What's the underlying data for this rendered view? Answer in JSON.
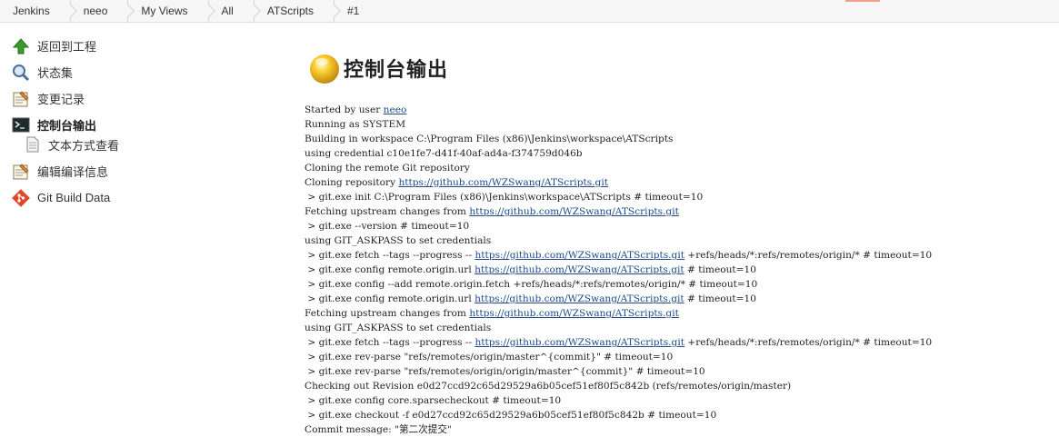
{
  "breadcrumbs": [
    "Jenkins",
    "neeo",
    "My Views",
    "All",
    "ATScripts",
    "#1"
  ],
  "sidebar": {
    "items": [
      {
        "label": "返回到工程",
        "icon": "up-arrow-icon"
      },
      {
        "label": "状态集",
        "icon": "magnifier-icon"
      },
      {
        "label": "变更记录",
        "icon": "notepad-icon"
      },
      {
        "label": "控制台输出",
        "icon": "terminal-icon",
        "active": true
      },
      {
        "label": "文本方式查看",
        "icon": "document-icon",
        "sub": true
      },
      {
        "label": "编辑编译信息",
        "icon": "notepad-icon"
      },
      {
        "label": "Git Build Data",
        "icon": "git-icon"
      }
    ]
  },
  "main": {
    "title": "控制台输出",
    "console": [
      {
        "pre": "Started by user ",
        "link": "neeo",
        "post": ""
      },
      {
        "pre": "Running as SYSTEM"
      },
      {
        "pre": "Building in workspace C:\\Program Files (x86)\\Jenkins\\workspace\\ATScripts"
      },
      {
        "pre": "using credential c10e1fe7-d41f-40af-ad4a-f374759d046b"
      },
      {
        "pre": "Cloning the remote Git repository"
      },
      {
        "pre": "Cloning repository ",
        "link": "https://github.com/WZSwang/ATScripts.git",
        "post": ""
      },
      {
        "pre": " > git.exe init C:\\Program Files (x86)\\Jenkins\\workspace\\ATScripts # timeout=10"
      },
      {
        "pre": "Fetching upstream changes from ",
        "link": "https://github.com/WZSwang/ATScripts.git",
        "post": ""
      },
      {
        "pre": " > git.exe --version # timeout=10"
      },
      {
        "pre": "using GIT_ASKPASS to set credentials"
      },
      {
        "pre": " > git.exe fetch --tags --progress -- ",
        "link": "https://github.com/WZSwang/ATScripts.git",
        "post": " +refs/heads/*:refs/remotes/origin/* # timeout=10"
      },
      {
        "pre": " > git.exe config remote.origin.url ",
        "link": "https://github.com/WZSwang/ATScripts.git",
        "post": " # timeout=10"
      },
      {
        "pre": " > git.exe config --add remote.origin.fetch +refs/heads/*:refs/remotes/origin/* # timeout=10"
      },
      {
        "pre": " > git.exe config remote.origin.url ",
        "link": "https://github.com/WZSwang/ATScripts.git",
        "post": " # timeout=10"
      },
      {
        "pre": "Fetching upstream changes from ",
        "link": "https://github.com/WZSwang/ATScripts.git",
        "post": ""
      },
      {
        "pre": "using GIT_ASKPASS to set credentials"
      },
      {
        "pre": " > git.exe fetch --tags --progress -- ",
        "link": "https://github.com/WZSwang/ATScripts.git",
        "post": " +refs/heads/*:refs/remotes/origin/* # timeout=10"
      },
      {
        "pre": " > git.exe rev-parse \"refs/remotes/origin/master^{commit}\" # timeout=10"
      },
      {
        "pre": " > git.exe rev-parse \"refs/remotes/origin/origin/master^{commit}\" # timeout=10"
      },
      {
        "pre": "Checking out Revision e0d27ccd92c65d29529a6b05cef51ef80f5c842b (refs/remotes/origin/master)"
      },
      {
        "pre": " > git.exe config core.sparsecheckout # timeout=10"
      },
      {
        "pre": " > git.exe checkout -f e0d27ccd92c65d29529a6b05cef51ef80f5c842b # timeout=10"
      },
      {
        "pre": "Commit message: \"第二次提交\""
      }
    ]
  }
}
